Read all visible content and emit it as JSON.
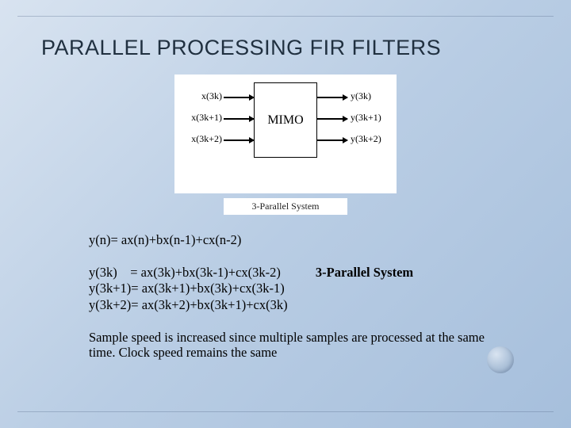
{
  "title": "PARALLEL PROCESSING FIR FILTERS",
  "diagram": {
    "box_label": "MIMO",
    "inputs": [
      "x(3k)",
      "x(3k+1)",
      "x(3k+2)"
    ],
    "outputs": [
      "y(3k)",
      "y(3k+1)",
      "y(3k+2)"
    ],
    "caption": "3-Parallel System"
  },
  "equations": {
    "base": "y(n)= ax(n)+bx(n-1)+cx(n-2)",
    "parallel": [
      "y(3k)    = ax(3k)+bx(3k-1)+cx(3k-2)",
      "y(3k+1)= ax(3k+1)+bx(3k)+cx(3k-1)",
      "y(3k+2)= ax(3k+2)+bx(3k+1)+cx(3k)"
    ],
    "system_label": "3-Parallel System"
  },
  "note": "Sample speed is increased since multiple samples are processed at the same time. Clock speed remains the same"
}
